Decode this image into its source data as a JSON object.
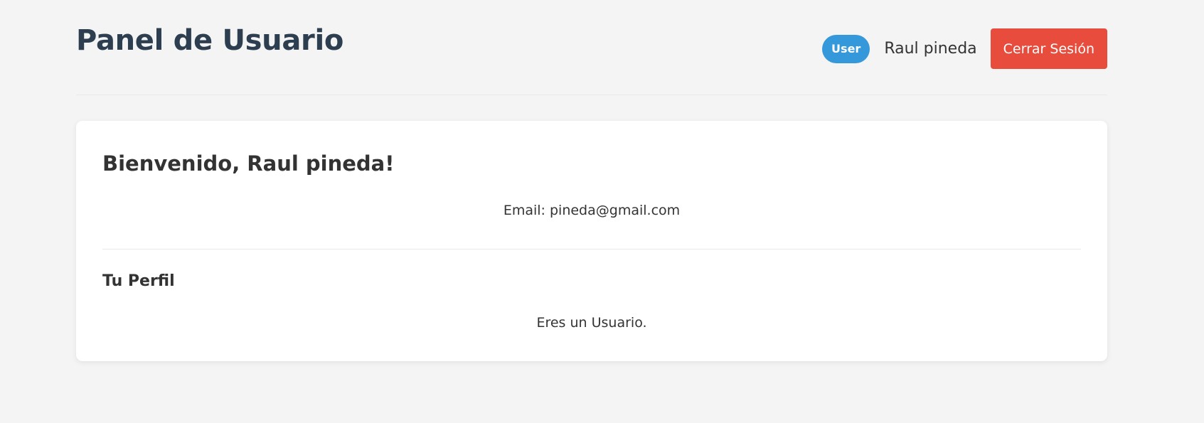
{
  "header": {
    "title": "Panel de Usuario",
    "role_badge": "User",
    "user_name": "Raul pineda",
    "logout_label": "Cerrar Sesión"
  },
  "card": {
    "welcome": "Bienvenido, Raul pineda!",
    "email": "Email: pineda@gmail.com",
    "profile_heading": "Tu Perfil",
    "role_text": "Eres un Usuario."
  },
  "colors": {
    "background": "#f4f4f4",
    "title": "#2c3e50",
    "badge": "#3498db",
    "logout": "#e74c3c",
    "card": "#ffffff"
  }
}
